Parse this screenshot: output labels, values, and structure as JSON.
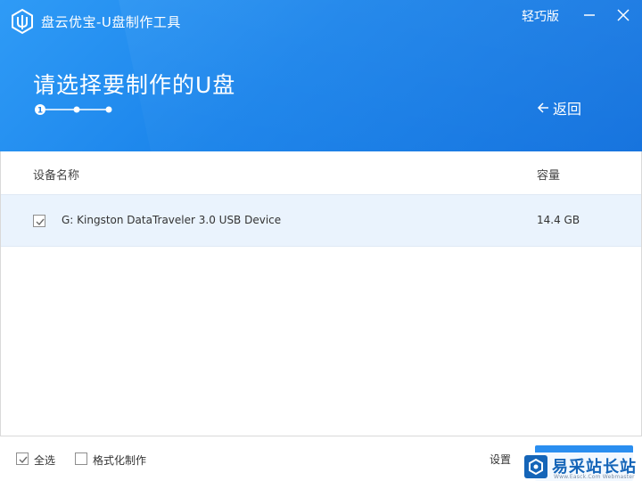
{
  "window": {
    "title": "盘云优宝-U盘制作工具",
    "lite_mode": "轻巧版"
  },
  "header": {
    "heading": "请选择要制作的U盘",
    "current_step": "1",
    "back_label": "返回"
  },
  "table": {
    "columns": {
      "name": "设备名称",
      "capacity": "容量"
    },
    "rows": [
      {
        "checked": true,
        "device": "G: Kingston DataTraveler 3.0 USB Device",
        "capacity": "14.4 GB"
      }
    ]
  },
  "footer": {
    "select_all": {
      "label": "全选",
      "checked": true
    },
    "format_make": {
      "label": "格式化制作",
      "checked": false
    },
    "settings_label": "设置"
  },
  "watermark": {
    "text": "易采站长站",
    "sub": "Www.Easck.Com Webmaster"
  },
  "colors": {
    "header_blue": "#1a83ea",
    "row_highlight": "#eaf3fd",
    "button_blue": "#2a8ef0",
    "watermark_blue": "#1565b8"
  },
  "icons": [
    "logo-icon",
    "minimize-icon",
    "close-icon",
    "back-arrow-icon",
    "check-icon",
    "easck-logo-icon"
  ]
}
